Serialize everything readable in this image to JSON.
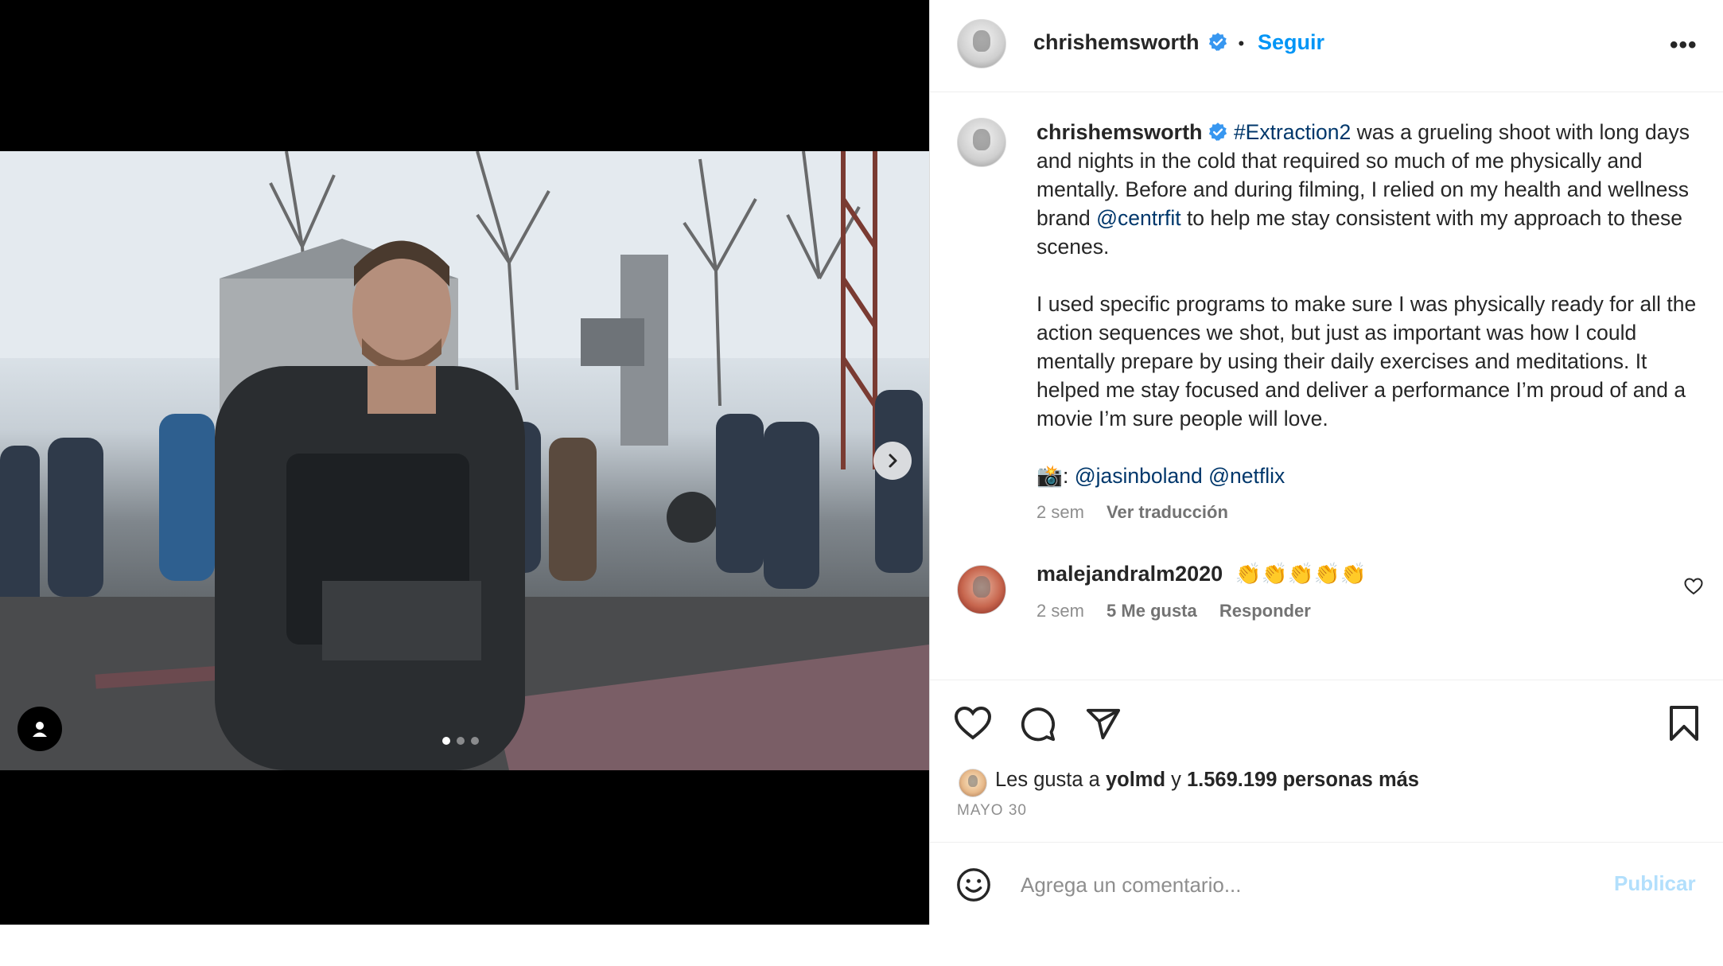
{
  "post": {
    "username": "chrishemsworth",
    "follow_label": "Seguir",
    "separator": "•",
    "more_label": "•••"
  },
  "caption": {
    "username": "chrishemsworth",
    "hashtag": "#Extraction2",
    "text_1": " was a grueling shoot with long days and nights in the cold that required so much of me physically and mentally. Before and during filming, I relied on my health and wellness brand ",
    "mention_brand": "@centrfit",
    "text_2": " to help me stay consistent with my approach to these scenes.",
    "paragraph_2": "I used specific programs to make sure I was physically ready for all the action sequences we shot, but just as important was how I could mentally prepare by using their daily exercises and meditations. It helped me stay focused and deliver a performance I’m proud of and a movie I’m sure people will love.",
    "camera_emoji": "📸",
    "credit_sep": ": ",
    "mention_1": "@jasinboland",
    "mention_2": "@netflix",
    "time": "2 sem",
    "translate_label": "Ver traducción"
  },
  "comments": [
    {
      "username": "malejandralm2020",
      "text": "👏👏👏👏👏",
      "time": "2 sem",
      "likes_label": "5 Me gusta",
      "reply_label": "Responder"
    }
  ],
  "likes": {
    "prefix": "Les gusta a ",
    "user": "yolmd",
    "middle": " y ",
    "count_text": "1.569.199 personas más"
  },
  "date": "MAYO 30",
  "add_comment": {
    "placeholder": "Agrega un comentario...",
    "publish_label": "Publicar"
  },
  "carousel": {
    "total": 3,
    "current": 1
  },
  "colors": {
    "accent": "#0095f6",
    "link": "#00376b",
    "muted": "#8e8e8e",
    "publish_disabled": "#b2dffc",
    "verified": "#3897f0"
  },
  "icons": [
    "verified-badge-icon",
    "more-options-icon",
    "chevron-right-icon",
    "user-tag-icon",
    "heart-icon",
    "comment-icon",
    "share-icon",
    "bookmark-icon",
    "emoji-icon"
  ]
}
